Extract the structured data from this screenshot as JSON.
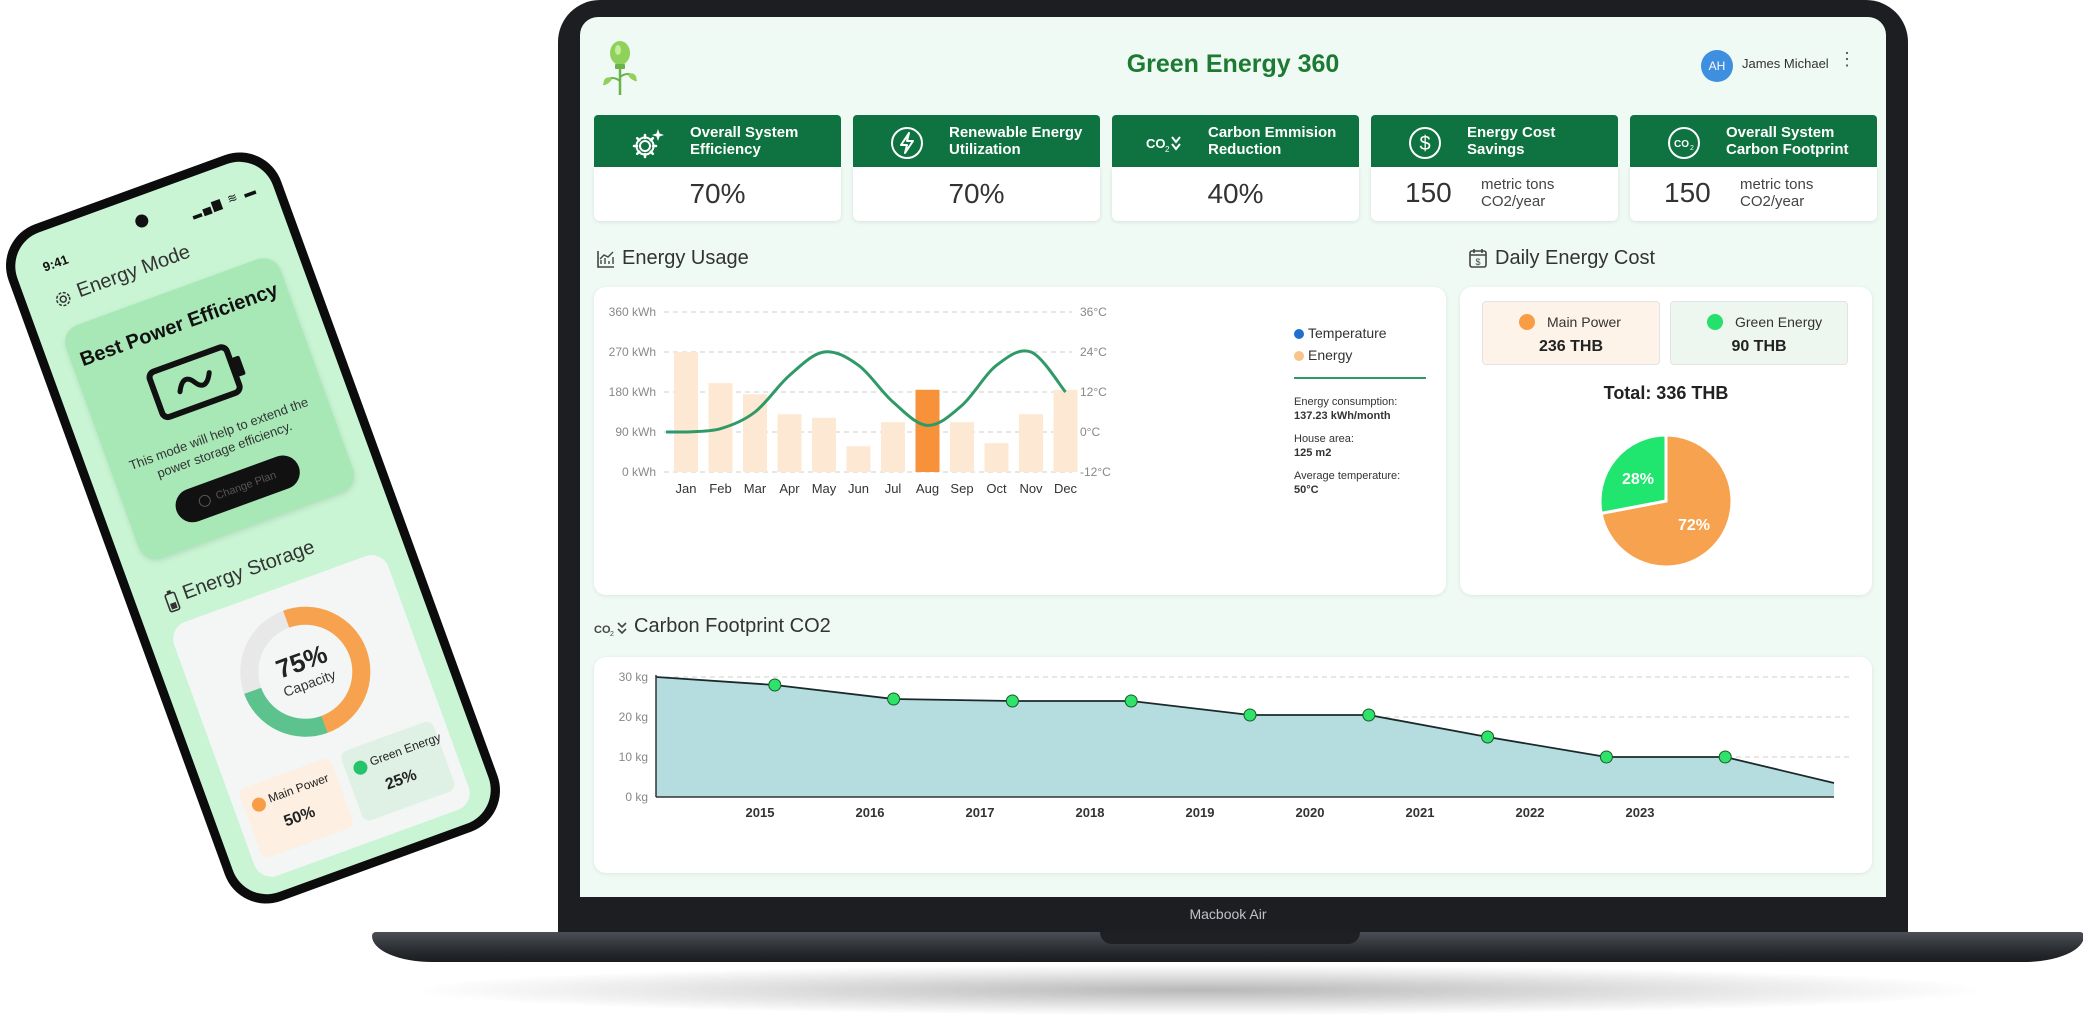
{
  "app": {
    "title": "Green Energy 360",
    "device_label": "Macbook Air"
  },
  "user": {
    "initials": "AH",
    "name": "James Michael",
    "menu": "⋮"
  },
  "kpis": [
    {
      "label": "Overall System Efficiency",
      "value": "70%",
      "unit": "",
      "icon": "gear-sparkle-icon"
    },
    {
      "label": "Renewable Energy Utilization",
      "value": "70%",
      "unit": "",
      "icon": "bolt-circle-icon"
    },
    {
      "label": "Carbon Emmision Reduction",
      "value": "40%",
      "unit": "",
      "icon": "co2-down-icon"
    },
    {
      "label": "Energy Cost Savings",
      "value": "150",
      "unit": "metric tons CO2/year",
      "icon": "dollar-circle-icon"
    },
    {
      "label": "Overall System Carbon Footprint",
      "value": "150",
      "unit": "metric tons CO2/year",
      "icon": "co2-circle-icon"
    }
  ],
  "usage": {
    "title": "Energy Usage",
    "legend": [
      {
        "label": "Temperature",
        "color": "#1f6fd1"
      },
      {
        "label": "Energy",
        "color": "#f8c48a"
      }
    ],
    "info": [
      {
        "label": "Energy consumption:",
        "value": "137.23 kWh/month"
      },
      {
        "label": "House area:",
        "value": "125 m2"
      },
      {
        "label": "Average temperature:",
        "value": "50°C"
      }
    ]
  },
  "cost": {
    "title": "Daily Energy Cost",
    "main": {
      "label": "Main Power",
      "value": "236 THB",
      "color": "#f89c45"
    },
    "green": {
      "label": "Green Energy",
      "value": "90 THB",
      "color": "#25e06b"
    },
    "total": "Total: 336 THB"
  },
  "carbon": {
    "title": "Carbon Footprint CO2"
  },
  "phone": {
    "time": "9:41",
    "status": "▂▄▆ ≋ ▬",
    "title": "Energy Mode",
    "mode_heading": "Best Power Efficiency",
    "mode_desc": "This mode will help to extend the power storage efficiency.",
    "button": "Change Plan",
    "storage_title": "Energy Storage",
    "capacity_pct": "75%",
    "capacity_label": "Capacity",
    "capacity_value": 75,
    "main": {
      "label": "Main Power",
      "value": "50%"
    },
    "green": {
      "label": "Green Energy",
      "value": "25%"
    }
  },
  "chart_data": [
    {
      "type": "bar",
      "categories": [
        "Jan",
        "Feb",
        "Mar",
        "Apr",
        "May",
        "Jun",
        "Jul",
        "Aug",
        "Sep",
        "Oct",
        "Nov",
        "Dec"
      ],
      "series": [
        {
          "name": "Energy",
          "axis": "left",
          "values": [
            270,
            200,
            175,
            130,
            122,
            58,
            112,
            185,
            112,
            65,
            130,
            185
          ],
          "highlight_index": 7
        },
        {
          "name": "Temperature",
          "axis": "right",
          "type": "line",
          "values": [
            0,
            1,
            6,
            17,
            24,
            20,
            9,
            2,
            8,
            20,
            24,
            12
          ]
        }
      ],
      "y_ticks_left": [
        "360 kWh",
        "270 kWh",
        "180 kWh",
        "90 kWh",
        "0 kWh"
      ],
      "y_ticks_right": [
        "36°C",
        "24°C",
        "12°C",
        "0°C",
        "-12°C"
      ],
      "ylim": [
        0,
        360
      ],
      "y2lim": [
        -12,
        36
      ],
      "grid": true,
      "legend": "right",
      "colors": {
        "bar": "#fde8d3",
        "highlight": "#f7913a",
        "line": "#2f9a68"
      }
    },
    {
      "type": "pie",
      "categories": [
        "Main Power",
        "Green Energy"
      ],
      "values": [
        72,
        28
      ],
      "labels": [
        "72%",
        "28%"
      ],
      "colors": [
        "#f7a24e",
        "#20e56e"
      ]
    },
    {
      "type": "area",
      "x": [
        "2014",
        "2015",
        "2016",
        "2017",
        "2018",
        "2019",
        "2020",
        "2021",
        "2022",
        "2023",
        "2024"
      ],
      "x_ticks": [
        "2015",
        "2016",
        "2017",
        "2018",
        "2019",
        "2020",
        "2021",
        "2022",
        "2023"
      ],
      "values": [
        30,
        28,
        24.5,
        24,
        24,
        20.5,
        20.5,
        15,
        10,
        10,
        3.5
      ],
      "y_ticks": [
        "30 kg",
        "20 kg",
        "10 kg",
        "0 kg"
      ],
      "ylim": [
        0,
        30
      ],
      "grid": true,
      "colors": {
        "fill": "#b5dcdf",
        "line": "#1a2a2a",
        "marker": "#2fe36a"
      }
    }
  ]
}
